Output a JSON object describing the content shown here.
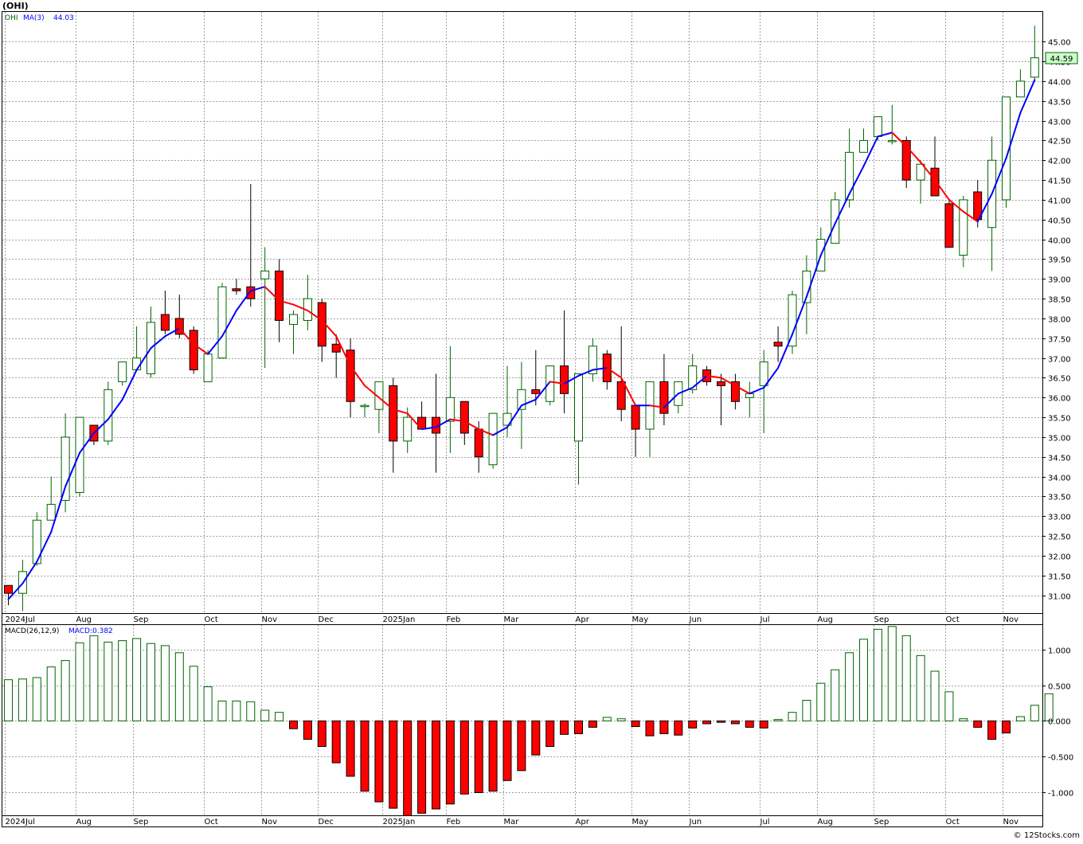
{
  "header": {
    "symbol_title": "(OHI)",
    "price_legend_symbol": "OHI",
    "ma_legend": "MA(3)",
    "ma_value": "44.03",
    "last_price_tag": "44.59",
    "macd_legend": "MACD(26,12,9)",
    "macd_value_legend": "MACD:0.382",
    "watermark": "© 12Stocks.com"
  },
  "colors": {
    "up_candle_fill": "#ffffff",
    "up_candle_stroke": "#006400",
    "down_candle_fill": "#ff0000",
    "ma_up": "#0000ff",
    "ma_down": "#ff0000",
    "grid": "#a0a0a0",
    "price_tag_bg": "#ccffcc"
  },
  "chart_data": [
    {
      "type": "candlestick",
      "interval": "weekly",
      "ylim": [
        30.55,
        45.75
      ],
      "y_ticks": [
        "31.00",
        "31.50",
        "32.00",
        "32.50",
        "33.00",
        "33.50",
        "34.00",
        "34.50",
        "35.00",
        "35.50",
        "36.00",
        "36.50",
        "37.00",
        "37.50",
        "38.00",
        "38.50",
        "39.00",
        "39.50",
        "40.00",
        "40.50",
        "41.00",
        "41.50",
        "42.00",
        "42.50",
        "43.00",
        "43.50",
        "44.00",
        "44.50",
        "45.00"
      ],
      "x_ticks": [
        {
          "label": "2024Jul",
          "index": 0
        },
        {
          "label": "Aug",
          "index": 5
        },
        {
          "label": "Sep",
          "index": 9
        },
        {
          "label": "Oct",
          "index": 14
        },
        {
          "label": "Nov",
          "index": 18
        },
        {
          "label": "Dec",
          "index": 22
        },
        {
          "label": "2025Jan",
          "index": 26.5
        },
        {
          "label": "Feb",
          "index": 31
        },
        {
          "label": "Mar",
          "index": 35
        },
        {
          "label": "Apr",
          "index": 40
        },
        {
          "label": "May",
          "index": 44
        },
        {
          "label": "Jun",
          "index": 48
        },
        {
          "label": "Jul",
          "index": 53
        },
        {
          "label": "Aug",
          "index": 57
        },
        {
          "label": "Sep",
          "index": 61
        },
        {
          "label": "Oct",
          "index": 66
        },
        {
          "label": "Nov",
          "index": 70
        }
      ],
      "candles": [
        {
          "o": 31.25,
          "h": 31.25,
          "l": 30.75,
          "c": 31.05
        },
        {
          "o": 31.05,
          "h": 31.9,
          "l": 30.6,
          "c": 31.6
        },
        {
          "o": 31.8,
          "h": 33.1,
          "l": 31.75,
          "c": 32.9
        },
        {
          "o": 32.9,
          "h": 34.0,
          "l": 32.9,
          "c": 33.3
        },
        {
          "o": 33.4,
          "h": 35.6,
          "l": 33.1,
          "c": 35.0
        },
        {
          "o": 33.6,
          "h": 35.5,
          "l": 33.5,
          "c": 35.5
        },
        {
          "o": 35.3,
          "h": 35.3,
          "l": 34.8,
          "c": 34.9
        },
        {
          "o": 34.9,
          "h": 36.4,
          "l": 34.8,
          "c": 36.2
        },
        {
          "o": 36.4,
          "h": 36.9,
          "l": 36.3,
          "c": 36.9
        },
        {
          "o": 36.7,
          "h": 37.8,
          "l": 36.7,
          "c": 37.0
        },
        {
          "o": 36.6,
          "h": 38.3,
          "l": 36.5,
          "c": 37.9
        },
        {
          "o": 38.1,
          "h": 38.7,
          "l": 37.6,
          "c": 37.7
        },
        {
          "o": 38.0,
          "h": 38.6,
          "l": 37.5,
          "c": 37.6
        },
        {
          "o": 37.7,
          "h": 37.8,
          "l": 36.6,
          "c": 36.7
        },
        {
          "o": 36.4,
          "h": 37.2,
          "l": 36.4,
          "c": 37.1
        },
        {
          "o": 37.0,
          "h": 38.9,
          "l": 37.0,
          "c": 38.8
        },
        {
          "o": 38.75,
          "h": 39.0,
          "l": 38.6,
          "c": 38.7
        },
        {
          "o": 38.8,
          "h": 41.4,
          "l": 38.3,
          "c": 38.5
        },
        {
          "o": 39.0,
          "h": 39.8,
          "l": 36.75,
          "c": 39.2
        },
        {
          "o": 39.2,
          "h": 39.5,
          "l": 37.4,
          "c": 37.95
        },
        {
          "o": 37.85,
          "h": 38.2,
          "l": 37.1,
          "c": 38.1
        },
        {
          "o": 37.95,
          "h": 39.1,
          "l": 37.7,
          "c": 38.5
        },
        {
          "o": 38.4,
          "h": 38.5,
          "l": 36.9,
          "c": 37.3
        },
        {
          "o": 37.35,
          "h": 37.6,
          "l": 36.5,
          "c": 37.15
        },
        {
          "o": 37.2,
          "h": 37.5,
          "l": 35.5,
          "c": 35.9
        },
        {
          "o": 35.8,
          "h": 35.85,
          "l": 35.5,
          "c": 35.8
        },
        {
          "o": 35.7,
          "h": 36.4,
          "l": 35.1,
          "c": 36.4
        },
        {
          "o": 36.3,
          "h": 36.5,
          "l": 34.1,
          "c": 34.9
        },
        {
          "o": 34.9,
          "h": 35.75,
          "l": 34.6,
          "c": 35.5
        },
        {
          "o": 35.5,
          "h": 35.9,
          "l": 35.2,
          "c": 35.2
        },
        {
          "o": 35.5,
          "h": 36.6,
          "l": 34.1,
          "c": 35.1
        },
        {
          "o": 35.4,
          "h": 37.3,
          "l": 34.6,
          "c": 36.0
        },
        {
          "o": 35.9,
          "h": 35.9,
          "l": 34.8,
          "c": 35.1
        },
        {
          "o": 35.2,
          "h": 35.4,
          "l": 34.1,
          "c": 34.5
        },
        {
          "o": 34.3,
          "h": 35.6,
          "l": 34.2,
          "c": 35.6
        },
        {
          "o": 35.3,
          "h": 36.8,
          "l": 35.0,
          "c": 35.6
        },
        {
          "o": 35.7,
          "h": 36.9,
          "l": 34.7,
          "c": 36.2
        },
        {
          "o": 36.2,
          "h": 37.2,
          "l": 35.8,
          "c": 36.1
        },
        {
          "o": 35.9,
          "h": 36.8,
          "l": 35.8,
          "c": 36.8
        },
        {
          "o": 36.8,
          "h": 38.2,
          "l": 35.6,
          "c": 36.1
        },
        {
          "o": 34.9,
          "h": 36.6,
          "l": 33.8,
          "c": 36.6
        },
        {
          "o": 36.6,
          "h": 37.5,
          "l": 36.4,
          "c": 37.3
        },
        {
          "o": 37.1,
          "h": 37.2,
          "l": 36.2,
          "c": 36.4
        },
        {
          "o": 36.4,
          "h": 37.8,
          "l": 35.4,
          "c": 35.7
        },
        {
          "o": 35.8,
          "h": 35.8,
          "l": 34.5,
          "c": 35.2
        },
        {
          "o": 35.2,
          "h": 36.4,
          "l": 34.5,
          "c": 36.4
        },
        {
          "o": 36.4,
          "h": 37.1,
          "l": 35.3,
          "c": 35.6
        },
        {
          "o": 35.8,
          "h": 36.4,
          "l": 35.6,
          "c": 36.4
        },
        {
          "o": 36.2,
          "h": 37.1,
          "l": 36.1,
          "c": 36.8
        },
        {
          "o": 36.7,
          "h": 36.8,
          "l": 36.3,
          "c": 36.4
        },
        {
          "o": 36.4,
          "h": 36.6,
          "l": 35.3,
          "c": 36.3
        },
        {
          "o": 36.4,
          "h": 36.6,
          "l": 35.7,
          "c": 35.9
        },
        {
          "o": 36.0,
          "h": 36.4,
          "l": 35.5,
          "c": 36.1
        },
        {
          "o": 36.3,
          "h": 37.2,
          "l": 35.1,
          "c": 36.9
        },
        {
          "o": 37.4,
          "h": 37.8,
          "l": 36.9,
          "c": 37.3
        },
        {
          "o": 37.3,
          "h": 38.7,
          "l": 37.1,
          "c": 38.6
        },
        {
          "o": 38.4,
          "h": 39.6,
          "l": 37.6,
          "c": 39.2
        },
        {
          "o": 39.2,
          "h": 40.3,
          "l": 39.2,
          "c": 40.0
        },
        {
          "o": 39.9,
          "h": 41.2,
          "l": 39.9,
          "c": 41.0
        },
        {
          "o": 41.0,
          "h": 42.8,
          "l": 40.8,
          "c": 42.2
        },
        {
          "o": 42.2,
          "h": 42.8,
          "l": 42.2,
          "c": 42.5
        },
        {
          "o": 42.6,
          "h": 43.1,
          "l": 42.5,
          "c": 43.1
        },
        {
          "o": 42.5,
          "h": 43.4,
          "l": 42.4,
          "c": 42.5
        },
        {
          "o": 42.5,
          "h": 42.6,
          "l": 41.3,
          "c": 41.5
        },
        {
          "o": 41.5,
          "h": 42.0,
          "l": 40.9,
          "c": 41.9
        },
        {
          "o": 41.8,
          "h": 42.6,
          "l": 41.1,
          "c": 41.1
        },
        {
          "o": 40.9,
          "h": 41.0,
          "l": 39.8,
          "c": 39.8
        },
        {
          "o": 39.6,
          "h": 41.1,
          "l": 39.3,
          "c": 41.0
        },
        {
          "o": 41.2,
          "h": 41.5,
          "l": 40.3,
          "c": 40.5
        },
        {
          "o": 40.3,
          "h": 42.6,
          "l": 39.2,
          "c": 42.0
        },
        {
          "o": 41.0,
          "h": 43.6,
          "l": 40.8,
          "c": 43.6
        },
        {
          "o": 43.6,
          "h": 44.3,
          "l": 43.6,
          "c": 44.0
        },
        {
          "o": 44.1,
          "h": 45.4,
          "l": 44.0,
          "c": 44.59
        }
      ],
      "ma": [
        30.9,
        31.3,
        31.85,
        32.6,
        33.75,
        34.6,
        35.1,
        35.45,
        35.95,
        36.7,
        37.25,
        37.55,
        37.75,
        37.35,
        37.1,
        37.55,
        38.2,
        38.7,
        38.8,
        38.45,
        38.35,
        38.2,
        37.95,
        37.55,
        36.8,
        36.3,
        36.0,
        35.7,
        35.6,
        35.2,
        35.25,
        35.45,
        35.4,
        35.2,
        35.05,
        35.25,
        35.8,
        35.95,
        36.4,
        36.35,
        36.55,
        36.7,
        36.75,
        36.5,
        35.8,
        35.8,
        35.75,
        36.1,
        36.25,
        36.55,
        36.5,
        36.3,
        36.1,
        36.25,
        36.75,
        37.6,
        38.55,
        39.6,
        40.4,
        41.15,
        41.85,
        42.6,
        42.7,
        42.35,
        41.95,
        41.5,
        41.0,
        40.7,
        40.45,
        41.15,
        42.05,
        43.2,
        44.03
      ]
    },
    {
      "type": "bar",
      "name": "MACD",
      "ylim": [
        -1.33,
        1.35
      ],
      "y_ticks": [
        "1.000",
        "0.500",
        "0.000",
        "-0.500",
        "-1.000"
      ],
      "values": [
        0.58,
        0.59,
        0.61,
        0.76,
        0.85,
        1.1,
        1.2,
        1.11,
        1.13,
        1.16,
        1.09,
        1.06,
        0.96,
        0.77,
        0.48,
        0.28,
        0.28,
        0.27,
        0.15,
        0.12,
        -0.11,
        -0.26,
        -0.36,
        -0.59,
        -0.78,
        -0.99,
        -1.14,
        -1.23,
        -1.34,
        -1.3,
        -1.24,
        -1.17,
        -1.03,
        -1.01,
        -0.99,
        -0.84,
        -0.7,
        -0.48,
        -0.36,
        -0.19,
        -0.18,
        -0.09,
        0.05,
        0.03,
        -0.08,
        -0.21,
        -0.18,
        -0.2,
        -0.1,
        -0.04,
        -0.02,
        -0.04,
        -0.09,
        -0.1,
        0.02,
        0.12,
        0.29,
        0.53,
        0.72,
        0.96,
        1.15,
        1.29,
        1.33,
        1.2,
        0.92,
        0.7,
        0.41,
        0.03,
        -0.09,
        -0.26,
        -0.17,
        0.06,
        0.22,
        0.382
      ]
    }
  ]
}
